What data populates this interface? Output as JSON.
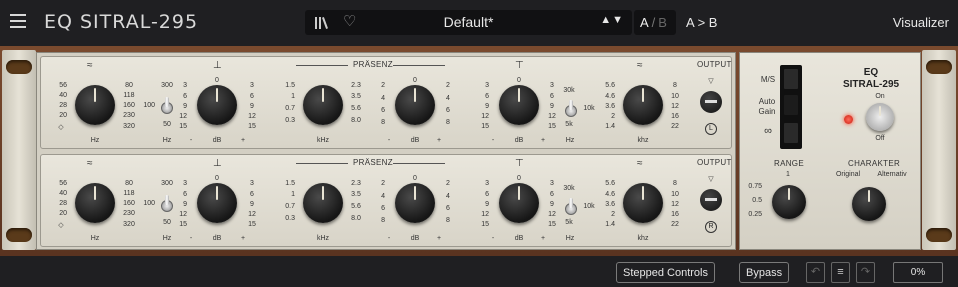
{
  "app": {
    "title": "EQ SITRAL-295"
  },
  "toolbar": {
    "preset_name": "Default*",
    "nav_arrows": "▲▼",
    "ab_a": "A",
    "ab_sep": "/",
    "ab_b": "B",
    "a_to_b": "A > B",
    "visualizer": "Visualizer"
  },
  "channel": {
    "low_freq_ticks_left": [
      "56",
      "40",
      "28",
      "20",
      "20"
    ],
    "low_freq_ticks_right": [
      "80",
      "118",
      "160",
      "230",
      "320"
    ],
    "low_freq_unit": "Hz",
    "hp_ticks": [
      "300",
      "100",
      "50"
    ],
    "hp_unit": "Hz",
    "gain_ticks_left": [
      "3",
      "6",
      "9",
      "12",
      "15"
    ],
    "gain_ticks_right": [
      "3",
      "6",
      "9",
      "12",
      "15"
    ],
    "gain_top": "0",
    "gain_minus": "-",
    "gain_unit": "dB",
    "gain_plus": "+",
    "praesenz": "PRÄSENZ",
    "pres_freq_left": [
      "1.5",
      "1",
      "0.7",
      "0.3"
    ],
    "pres_freq_right": [
      "2.3",
      "3.5",
      "5.6",
      "8.0"
    ],
    "pres_freq_unit": "kHz",
    "pres_gain_left": [
      "2",
      "4",
      "6",
      "8"
    ],
    "pres_gain_right": [
      "2",
      "4",
      "6",
      "8"
    ],
    "hi_gain_left": [
      "3",
      "6",
      "9",
      "12",
      "15"
    ],
    "hi_gain_right": [
      "3",
      "6",
      "9",
      "12",
      "15"
    ],
    "hi_switch": [
      "30k",
      "10k",
      "5k"
    ],
    "hi_switch_unit": "Hz",
    "hi_freq_left": [
      "5.6",
      "4.6",
      "3.6",
      "2",
      "1.4"
    ],
    "hi_freq_right": [
      "8",
      "10",
      "12",
      "16",
      "22"
    ],
    "hi_freq_unit": "khz",
    "output": "OUTPUT"
  },
  "channels": [
    {
      "badge": "L"
    },
    {
      "badge": "R"
    }
  ],
  "right_panel": {
    "ms": "M/S",
    "auto_gain_1": "Auto",
    "auto_gain_2": "Gain",
    "brand_1": "EQ",
    "brand_2": "SITRAL-295",
    "power_on": "On",
    "power_off": "Off",
    "range": "RANGE",
    "range_ticks": [
      "1",
      "0.75",
      "0.5",
      "0.25"
    ],
    "charakter": "CHARAKTER",
    "char_original": "Original",
    "char_alternativ": "Alternativ"
  },
  "bottom": {
    "stepped": "Stepped Controls",
    "bypass": "Bypass",
    "undo": "↶",
    "history": "≡",
    "redo": "↷",
    "cpu": "0%"
  }
}
